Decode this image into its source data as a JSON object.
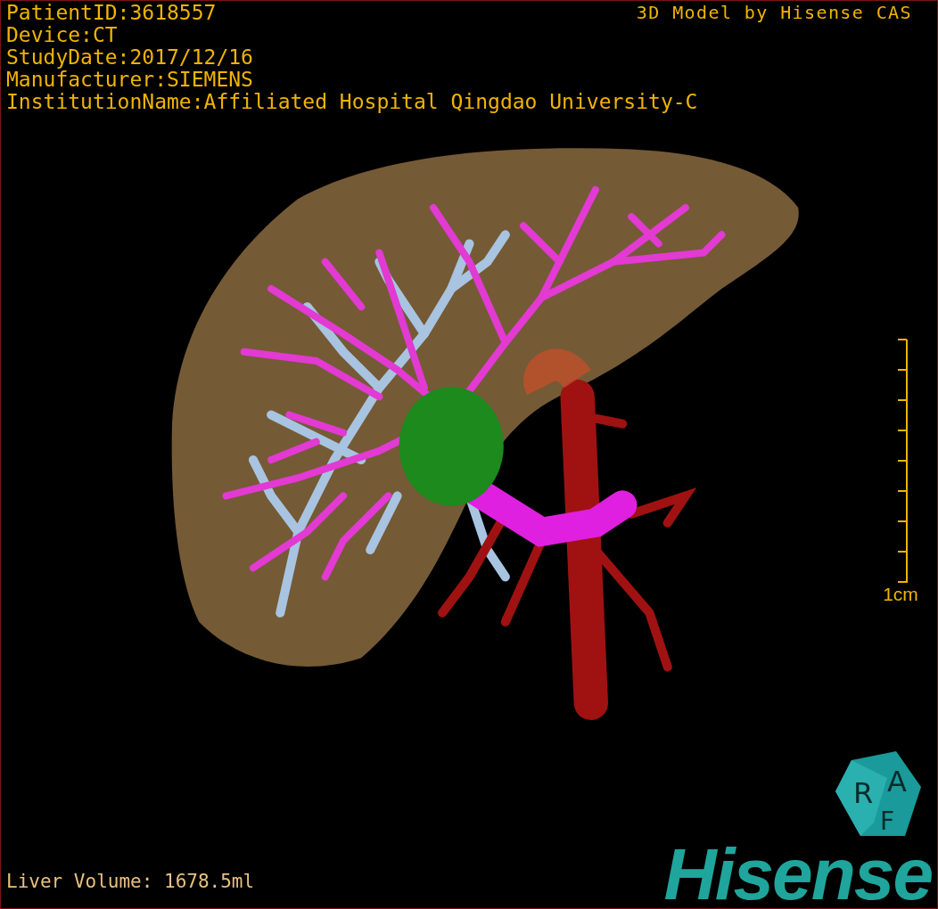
{
  "header": {
    "lines": [
      "PatientID:3618557",
      "Device:CT",
      "StudyDate:2017/12/16",
      "Manufacturer:SIEMENS",
      "InstitutionName:Affiliated Hospital Qingdao University-C"
    ],
    "model_credit": "3D Model by Hisense CAS"
  },
  "scale_bar": {
    "label": "1cm"
  },
  "orientation_cube": {
    "faces": [
      "R",
      "A",
      "F"
    ]
  },
  "footer": {
    "liver_volume": "Liver Volume: 1678.5ml"
  },
  "logo": {
    "text": "Hisense"
  }
}
